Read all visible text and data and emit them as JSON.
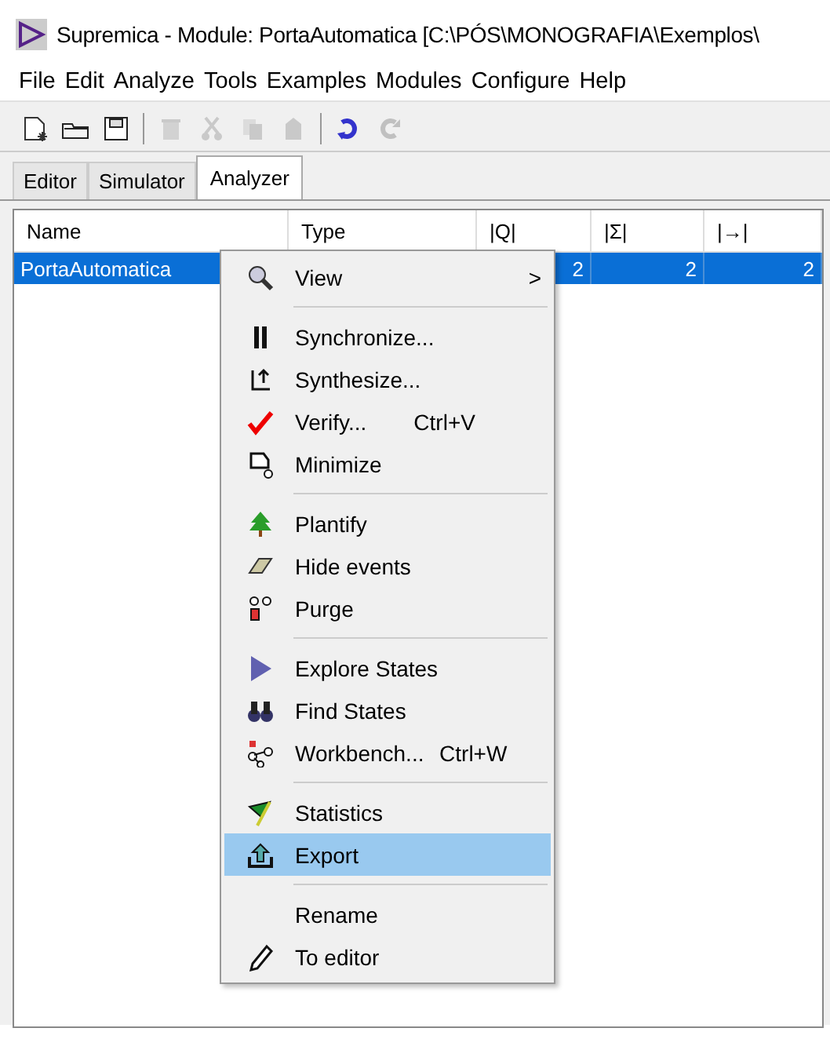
{
  "window": {
    "title": "Supremica - Module: PortaAutomatica [C:\\PÓS\\MONOGRAFIA\\Exemplos\\"
  },
  "menu_bar": [
    "File",
    "Edit",
    "Analyze",
    "Tools",
    "Examples",
    "Modules",
    "Configure",
    "Help"
  ],
  "toolbar": [
    {
      "disabled": false
    },
    {
      "disabled": false
    },
    {
      "disabled": false
    },
    {
      "disabled": true
    },
    {
      "disabled": true
    },
    {
      "disabled": true
    },
    {
      "disabled": true
    },
    {
      "disabled": false
    },
    {
      "disabled": true
    }
  ],
  "tabs": [
    {
      "label": "Editor",
      "selected": false
    },
    {
      "label": "Simulator",
      "selected": false
    },
    {
      "label": "Analyzer",
      "selected": true
    }
  ],
  "table": {
    "columns": [
      "Name",
      "Type",
      "|Q|",
      "|Σ|",
      "|→|"
    ],
    "rows": [
      {
        "name": "PortaAutomatica",
        "q": "2",
        "sigma": "2",
        "transitions": "2",
        "selected": true
      }
    ]
  },
  "context_menu": [
    {
      "kind": "item",
      "label": "View",
      "submenu": ">",
      "selected": false
    },
    {
      "kind": "separator"
    },
    {
      "kind": "item",
      "label": "Synchronize...",
      "selected": false
    },
    {
      "kind": "item",
      "label": "Synthesize...",
      "selected": false
    },
    {
      "kind": "item",
      "label": "Verify...",
      "shortcut": "Ctrl+V",
      "selected": false
    },
    {
      "kind": "item",
      "label": "Minimize",
      "selected": false
    },
    {
      "kind": "separator"
    },
    {
      "kind": "item",
      "label": "Plantify",
      "selected": false
    },
    {
      "kind": "item",
      "label": "Hide events",
      "selected": false
    },
    {
      "kind": "item",
      "label": "Purge",
      "selected": false
    },
    {
      "kind": "separator"
    },
    {
      "kind": "item",
      "label": "Explore States",
      "selected": false
    },
    {
      "kind": "item",
      "label": "Find States",
      "selected": false
    },
    {
      "kind": "item",
      "label": "Workbench...",
      "shortcut": "Ctrl+W",
      "selected": false
    },
    {
      "kind": "separator"
    },
    {
      "kind": "item",
      "label": "Statistics",
      "selected": false
    },
    {
      "kind": "item",
      "label": "Export",
      "selected": true
    },
    {
      "kind": "separator"
    },
    {
      "kind": "item",
      "label": "Rename",
      "selected": false
    },
    {
      "kind": "item",
      "label": "To editor",
      "selected": false
    }
  ]
}
